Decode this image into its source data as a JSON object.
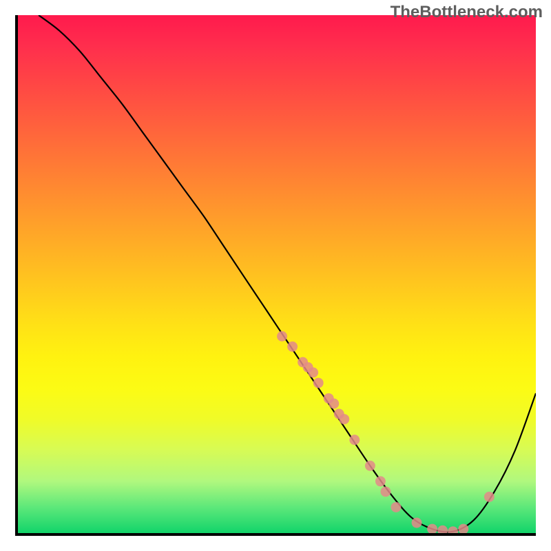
{
  "watermark": "TheBottleneck.com",
  "chart_data": {
    "type": "line",
    "title": "",
    "xlabel": "",
    "ylabel": "",
    "xlim": [
      0,
      100
    ],
    "ylim": [
      0,
      100
    ],
    "grid": false,
    "annotations": [],
    "series": [
      {
        "name": "curve",
        "color": "#000000",
        "x": [
          4,
          8,
          12,
          16,
          20,
          24,
          28,
          32,
          36,
          40,
          44,
          48,
          52,
          56,
          60,
          64,
          68,
          72,
          76,
          80,
          84,
          88,
          92,
          96,
          100
        ],
        "y": [
          100,
          97,
          93,
          88,
          83,
          77.5,
          72,
          66.5,
          61,
          55,
          49,
          43,
          37,
          31,
          25,
          19,
          13,
          7.5,
          3,
          0.8,
          0.3,
          2.5,
          8,
          16,
          27
        ]
      },
      {
        "name": "markers",
        "type": "scatter",
        "color": "#e48080",
        "x_approx": [
          51,
          53,
          55,
          56,
          57,
          58,
          60,
          61,
          62,
          63,
          65,
          68,
          70,
          71,
          73,
          77,
          80,
          82,
          84,
          86,
          91
        ],
        "y_approx": [
          38,
          36,
          33,
          32,
          31,
          29,
          26,
          25,
          23,
          22,
          18,
          13,
          10,
          8,
          5,
          2,
          0.8,
          0.5,
          0.3,
          0.8,
          7
        ]
      }
    ],
    "background_gradient_stops": [
      {
        "pos": 0.0,
        "color": "#ff1a4d"
      },
      {
        "pos": 0.25,
        "color": "#ff7030"
      },
      {
        "pos": 0.5,
        "color": "#ffc020"
      },
      {
        "pos": 0.72,
        "color": "#fcfb14"
      },
      {
        "pos": 0.9,
        "color": "#b0f87e"
      },
      {
        "pos": 1.0,
        "color": "#12d46a"
      }
    ]
  }
}
